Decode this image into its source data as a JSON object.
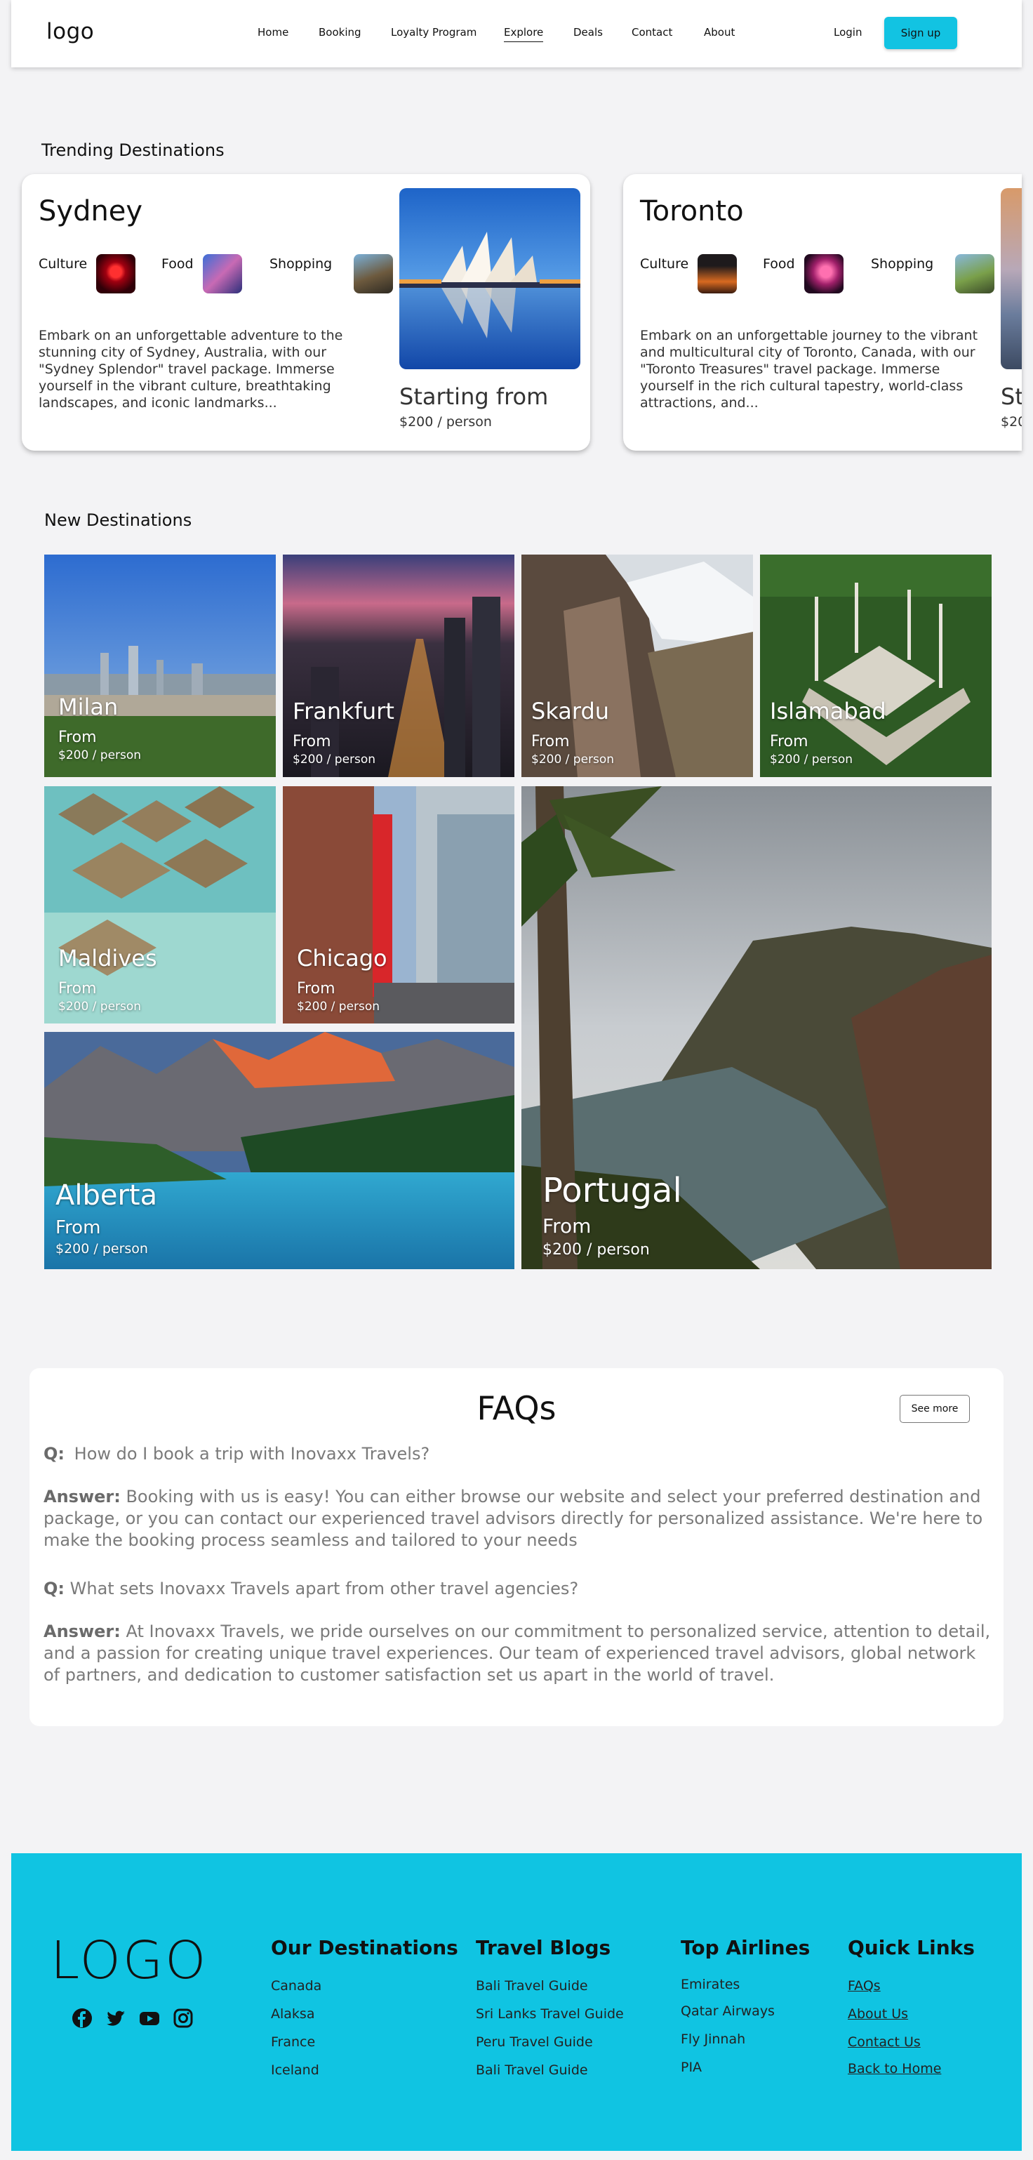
{
  "nav": {
    "logo": "logo",
    "links": [
      "Home",
      "Booking",
      "Loyalty Program",
      "Explore",
      "Deals",
      "Contact",
      "About"
    ],
    "active": "Explore",
    "login": "Login",
    "signup": "Sign up"
  },
  "trending": {
    "title": "Trending Destinations",
    "cards": [
      {
        "city": "Sydney",
        "tags": [
          "Culture",
          "Food",
          "Shopping"
        ],
        "description": "Embark on an unforgettable adventure to the stunning city of Sydney, Australia, with our \"Sydney Splendor\" travel package. Immerse yourself in the vibrant culture, breathtaking landscapes, and iconic landmarks...",
        "starting": "Starting from",
        "price": "$200 / person"
      },
      {
        "city": "Toronto",
        "tags": [
          "Culture",
          "Food",
          "Shopping"
        ],
        "description": "Embark on an unforgettable journey to the vibrant and multicultural city of Toronto, Canada, with our \"Toronto Treasures\" travel package. Immerse yourself in the rich cultural tapestry, world-class attractions, and...",
        "starting": "St",
        "price": "$20"
      }
    ]
  },
  "new_destinations": {
    "title": "New Destinations",
    "from_label": "From",
    "tiles": [
      {
        "name": "Milan",
        "price": "$200 / person"
      },
      {
        "name": "Frankfurt",
        "price": "$200 / person"
      },
      {
        "name": "Skardu",
        "price": "$200 / person"
      },
      {
        "name": "Islamabad",
        "price": "$200 / person"
      },
      {
        "name": "Maldives",
        "price": "$200 / person"
      },
      {
        "name": "Chicago",
        "price": "$200 / person"
      },
      {
        "name": "Portugal",
        "price": "$200 / person"
      },
      {
        "name": "Alberta",
        "price": "$200 / person"
      }
    ]
  },
  "faq": {
    "title": "FAQs",
    "see_more": "See more",
    "q_label": "Q:",
    "a_label": "Answer:",
    "items": [
      {
        "q": "How do I book a trip with Inovaxx Travels?",
        "a": "Booking with us is easy! You can either browse our website and select your preferred destination and package, or you can contact our experienced travel advisors directly for personalized assistance. We're here to make the booking process seamless and tailored to your needs"
      },
      {
        "q": "What sets Inovaxx Travels apart from other travel agencies?",
        "a": "At Inovaxx Travels, we pride ourselves on our commitment to personalized service, attention to detail, and a passion for creating unique travel experiences. Our team of experienced travel advisors, global network of partners, and dedication to customer satisfaction set us apart in the world of travel."
      }
    ]
  },
  "footer": {
    "logo": "LOGO",
    "social": [
      "facebook-icon",
      "twitter-icon",
      "youtube-icon",
      "instagram-icon"
    ],
    "columns": [
      {
        "title": "Our Destinations",
        "items": [
          "Canada",
          "Alaksa",
          "France",
          "Iceland"
        ]
      },
      {
        "title": "Travel Blogs",
        "items": [
          "Bali Travel Guide",
          "Sri Lanks Travel Guide",
          "Peru Travel Guide",
          "Bali Travel Guide"
        ]
      },
      {
        "title": "Top Airlines",
        "items": [
          "Emirates",
          "Qatar Airways",
          "Fly Jinnah",
          "PIA"
        ]
      },
      {
        "title": "Quick Links",
        "items": [
          "FAQs",
          "About Us",
          "Contact Us",
          "Back to Home"
        ]
      }
    ]
  },
  "colors": {
    "accent": "#12c3e2",
    "footer_bg": "#10c4e2"
  }
}
